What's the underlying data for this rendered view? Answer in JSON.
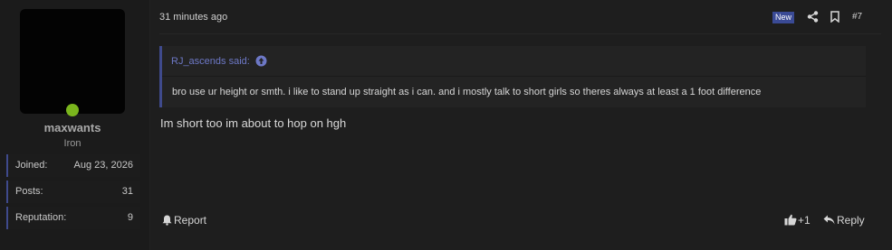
{
  "user": {
    "username": "maxwants",
    "title": "Iron",
    "online_color": "#7ab51d",
    "stats": [
      {
        "label": "Joined:",
        "value": "Aug 23, 2026"
      },
      {
        "label": "Posts:",
        "value": "31"
      },
      {
        "label": "Reputation:",
        "value": "9"
      }
    ]
  },
  "post": {
    "timestamp": "31 minutes ago",
    "badge": "New",
    "number": "#7",
    "quote": {
      "author_line": "RJ_ascends said:",
      "text": "bro use ur height or smth. i like to stand up straight as i can. and i mostly talk to short girls so theres always at least a 1 foot difference"
    },
    "message": "Im short too im about to hop on hgh"
  },
  "actions": {
    "report": "Report",
    "like_count": "+1",
    "reply": "Reply"
  },
  "colors": {
    "accent": "#3f4a8c",
    "link": "#6d78c6",
    "background": "#1e1e1e"
  }
}
